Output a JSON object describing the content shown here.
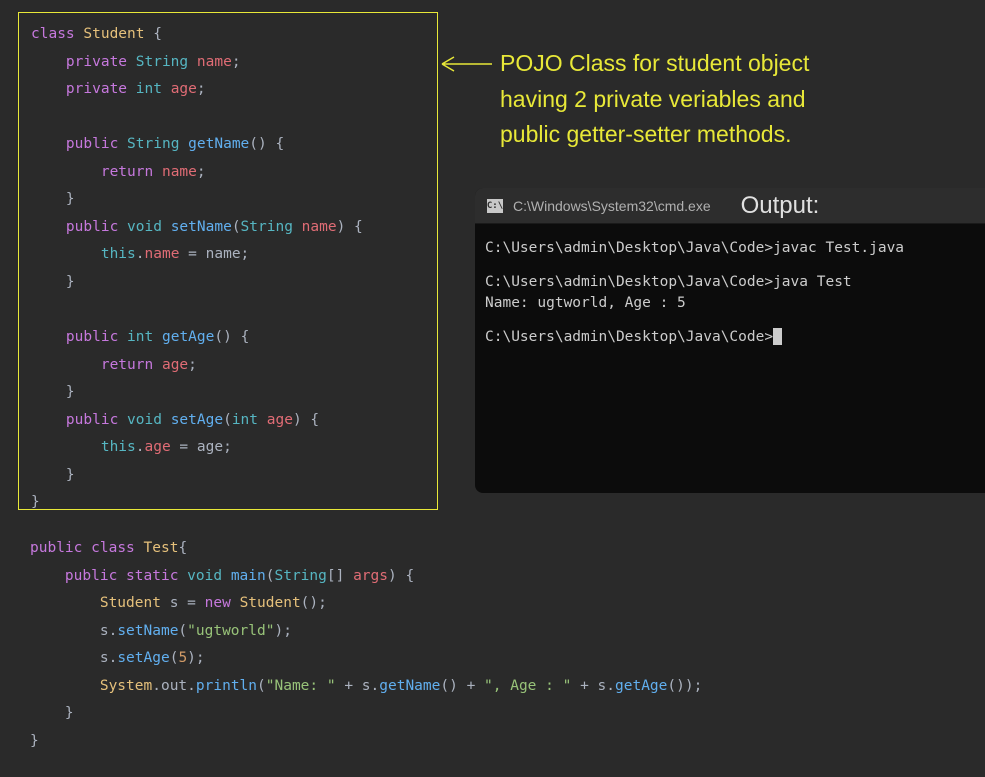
{
  "annotation": {
    "line1": "POJO Class for student object",
    "line2": "having 2 private veriables and",
    "line3": "public getter-setter methods."
  },
  "code_upper": {
    "l1_kw": "class",
    "l1_cls": "Student",
    "l1_brace": " {",
    "l2_kw": "private",
    "l2_type": "String",
    "l2_var": "name",
    "l2_end": ";",
    "l3_kw": "private",
    "l3_type": "int",
    "l3_var": "age",
    "l3_end": ";",
    "l4_kw": "public",
    "l4_type": "String",
    "l4_method": "getName",
    "l4_end": "() {",
    "l5_kw": "return",
    "l5_var": "name",
    "l5_end": ";",
    "l6_brace": "}",
    "l7_kw": "public",
    "l7_type": "void",
    "l7_method": "setName",
    "l7_p1": "(",
    "l7_ptype": "String",
    "l7_pvar": "name",
    "l7_p2": ") {",
    "l8_this": "this",
    "l8_dot": ".",
    "l8_var": "name",
    "l8_eq": " = ",
    "l8_var2": "name",
    "l8_end": ";",
    "l9_brace": "}",
    "l10_kw": "public",
    "l10_type": "int",
    "l10_method": "getAge",
    "l10_end": "() {",
    "l11_kw": "return",
    "l11_var": "age",
    "l11_end": ";",
    "l12_brace": "}",
    "l13_kw": "public",
    "l13_type": "void",
    "l13_method": "setAge",
    "l13_p1": "(",
    "l13_ptype": "int",
    "l13_pvar": "age",
    "l13_p2": ") {",
    "l14_this": "this",
    "l14_dot": ".",
    "l14_var": "age",
    "l14_eq": " = ",
    "l14_var2": "age",
    "l14_end": ";",
    "l15_brace": "}",
    "l16_brace": "}"
  },
  "code_lower": {
    "l1_kw1": "public",
    "l1_kw2": "class",
    "l1_cls": "Test",
    "l1_brace": "{",
    "l2_kw1": "public",
    "l2_kw2": "static",
    "l2_type": "void",
    "l2_method": "main",
    "l2_p1": "(",
    "l2_ptype": "String",
    "l2_arr": "[] ",
    "l2_pvar": "args",
    "l2_p2": ") {",
    "l3_cls": "Student",
    "l3_var": "s",
    "l3_eq": " = ",
    "l3_kw": "new",
    "l3_ctor": "Student",
    "l3_end": "();",
    "l4_var": "s",
    "l4_dot": ".",
    "l4_method": "setName",
    "l4_p1": "(",
    "l4_str": "\"ugtworld\"",
    "l4_p2": ");",
    "l5_var": "s",
    "l5_dot": ".",
    "l5_method": "setAge",
    "l5_p1": "(",
    "l5_num": "5",
    "l5_p2": ");",
    "l6_cls": "System",
    "l6_d1": ".",
    "l6_out": "out",
    "l6_d2": ".",
    "l6_method": "println",
    "l6_p1": "(",
    "l6_s1": "\"Name: \"",
    "l6_plus1": " + ",
    "l6_var1": "s",
    "l6_d3": ".",
    "l6_m1": "getName",
    "l6_c1": "() + ",
    "l6_s2": "\", Age : \"",
    "l6_plus2": " + ",
    "l6_var2": "s",
    "l6_d4": ".",
    "l6_m2": "getAge",
    "l6_c2": "());",
    "l7_brace": "}",
    "l8_brace": "}"
  },
  "terminal": {
    "title": "C:\\Windows\\System32\\cmd.exe",
    "output_label": "Output:",
    "line1": "C:\\Users\\admin\\Desktop\\Java\\Code>javac Test.java",
    "line2a": "C:\\Users\\admin\\Desktop\\Java\\Code>java Test",
    "line2b": "Name: ugtworld, Age : 5",
    "line3": "C:\\Users\\admin\\Desktop\\Java\\Code>"
  }
}
